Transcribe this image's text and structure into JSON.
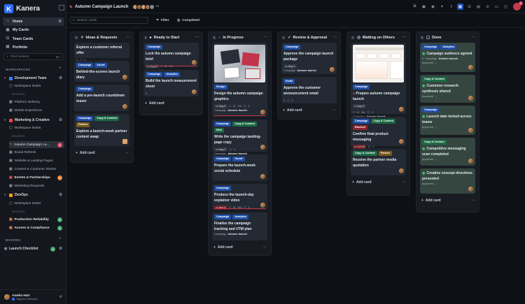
{
  "app": {
    "name": "Kanera"
  },
  "sidebar": {
    "nav": [
      {
        "label": "Home",
        "icon": "home-icon"
      },
      {
        "label": "My Cards",
        "icon": "cards-icon"
      },
      {
        "label": "Team Cards",
        "icon": "team-icon"
      },
      {
        "label": "Portfolio",
        "icon": "portfolio-icon"
      }
    ],
    "search_placeholder": "Find content",
    "search_kbd": "⌘K",
    "workspaces_heading": "WORKSPACES",
    "boards_label": "BOARDS",
    "boards_heading": "BOARDS",
    "workspaces": [
      {
        "name": "Development Team",
        "color": "#3b82f6",
        "notes": "Workspace Notes",
        "boards": [
          {
            "name": "Platform Delivery"
          },
          {
            "name": "Mobile Experience"
          }
        ]
      },
      {
        "name": "Marketing & Creative",
        "color": "#ef4444",
        "notes": "Workspace Notes",
        "boards": [
          {
            "name": "Autumn Campaign La...",
            "badge": "3"
          },
          {
            "name": "Brand Refresh"
          },
          {
            "name": "Website & Landing Pages"
          },
          {
            "name": "Content & Customer Stories"
          },
          {
            "name": "Events & Partnerships",
            "badge": "5"
          },
          {
            "name": "Marketing Requests"
          }
        ]
      },
      {
        "name": "DevOps",
        "color": "#f59e0b",
        "notes": "Workspace Notes",
        "boards": [
          {
            "name": "Production Reliability",
            "badge": "6"
          },
          {
            "name": "Access & Compliance",
            "badge": "2"
          }
        ]
      }
    ],
    "starred_board": {
      "name": "Launch Checklist",
      "badge": "4"
    },
    "user": {
      "name": "Amelia Hart",
      "org": "Happen Software"
    }
  },
  "topbar": {
    "board_title": "Autumn Campaign Launch",
    "avatar_extra": "+2",
    "notification_count": "3"
  },
  "toolbar": {
    "search_placeholder": "Search cards",
    "filter_label": "Filter",
    "completed_label": "Completed"
  },
  "columns": [
    {
      "title": "Ideas & Requests",
      "count": "5",
      "add_label": "Add card",
      "cards": [
        {
          "title": "Explore a customer referral offer",
          "tags": [],
          "comments": "1"
        },
        {
          "title": "Behind-the-scenes launch diary",
          "tags": [
            "Campaign",
            "Social"
          ]
        },
        {
          "title": "Add a pre-launch countdown teaser",
          "tags": [
            "Campaign"
          ]
        },
        {
          "title": "Explore a launch-week partner content swap",
          "tags": [
            "Campaign",
            "Copy & Content",
            "Partner"
          ]
        }
      ]
    },
    {
      "title": "Ready to Start",
      "count": "2",
      "add_label": "Add card",
      "cards": [
        {
          "title": "Lock the autumn campaign brief",
          "tags": [
            "Campaign"
          ],
          "date": "Aug 2",
          "checklist": "2/4",
          "project": "Campaign",
          "project_name": "Autumn launch"
        },
        {
          "title": "Build the launch measurement sheet",
          "tags": [
            "Campaign",
            "Analytics"
          ]
        }
      ]
    },
    {
      "title": "In Progress",
      "count": "5",
      "add_label": "Add card",
      "cards": [
        {
          "title": "Design the autumn campaign graphics",
          "tags": [
            "Design"
          ],
          "date": "Aug 5",
          "checklist": "3/4",
          "comments": "2",
          "project": "Campaign",
          "project_name": "Autumn launch"
        },
        {
          "title": "Write the campaign landing-page copy",
          "tags": [
            "Campaign",
            "Copy & Content",
            "Web"
          ],
          "date": "Aug 2",
          "comments": "1",
          "project": "Campaign",
          "project_name": "Autumn launch"
        },
        {
          "title": "Prepare the launch-week social schedule",
          "tags": [
            "Campaign",
            "Social"
          ]
        },
        {
          "title": "Produce the launch-day explainer video",
          "tags": [
            "Campaign"
          ],
          "date": "Aug 4",
          "checklist": "3/4",
          "comments": "1"
        },
        {
          "title": "Finalise the campaign tracking and UTM plan",
          "tags": [
            "Campaign",
            "Analytics"
          ],
          "project": "Campaign",
          "project_name": "Autumn launch"
        }
      ]
    },
    {
      "title": "Review & Approval",
      "count": "2",
      "add_label": "Add card",
      "cards": [
        {
          "title": "Approve the campaign launch package",
          "tags": [
            "Campaign"
          ],
          "date": "Aug 4",
          "project": "Campaign",
          "project_name": "Autumn launch"
        },
        {
          "title": "Approve the customer announcement email",
          "tags": [
            "Email"
          ],
          "comments": "1"
        }
      ]
    },
    {
      "title": "Waiting on Others",
      "count": "3",
      "add_label": "Add card",
      "cards": [
        {
          "title": "Prepare autumn campaign launch",
          "tags": [
            "Campaign"
          ],
          "date": "Aug 5",
          "checklist": "3/4",
          "comments": "2",
          "project": "Campaign",
          "project_name": "Autumn launch"
        },
        {
          "title": "Confirm final product messaging",
          "tags": [
            "Campaign",
            "Copy & Content",
            "Blocked"
          ],
          "date": "Jul 30",
          "comments": "1"
        },
        {
          "title": "Receive the partner media quotation",
          "tags": [
            "Copy & Content",
            "Partner"
          ]
        }
      ]
    },
    {
      "title": "Done",
      "count": "5",
      "add_label": "Add card",
      "cards": [
        {
          "title": "Campaign audience agreed",
          "tags": [
            "Campaign",
            "Analytics"
          ],
          "approved": "Approved",
          "project": "Campaign",
          "project_name": "Autumn launch"
        },
        {
          "title": "Customer research synthesis shared",
          "tags": [
            "Copy & Content"
          ],
          "approved": "Approved"
        },
        {
          "title": "Launch date locked across teams",
          "tags": [
            "Campaign"
          ],
          "approved": "Approved"
        },
        {
          "title": "Competitive messaging scan completed",
          "tags": [
            "Copy & Content"
          ],
          "approved": "Approved"
        },
        {
          "title": "Creative concept directions presented",
          "tags": [],
          "approved": "Approved"
        }
      ]
    }
  ]
}
